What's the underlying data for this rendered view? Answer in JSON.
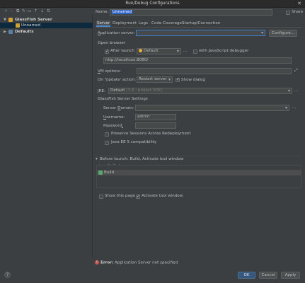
{
  "window": {
    "title": "Run/Debug Configurations",
    "close_glyph": "✕"
  },
  "left_toolbar": {
    "icons": [
      {
        "name": "add-icon",
        "glyph": "+",
        "color": "#59a869"
      },
      {
        "name": "remove-icon",
        "glyph": "−",
        "color": "#c75450"
      },
      {
        "name": "copy-icon",
        "glyph": "⧉",
        "color": "#9aa7b0"
      },
      {
        "name": "edit-icon",
        "glyph": "✎",
        "color": "#9aa7b0"
      },
      {
        "name": "folder-icon",
        "glyph": "▭",
        "color": "#9aa7b0"
      },
      {
        "name": "move-up-icon",
        "glyph": "↑",
        "color": "#9aa7b0"
      },
      {
        "name": "move-down-icon",
        "glyph": "↓",
        "color": "#9aa7b0"
      },
      {
        "name": "sort-icon",
        "glyph": "⇅",
        "color": "#9aa7b0"
      }
    ]
  },
  "tree": {
    "group": "GlassFish Server",
    "child": "Unnamed",
    "defaults": "Defaults"
  },
  "config": {
    "name_label": "Name:",
    "name_value": "Unnamed",
    "share_label": "Share",
    "tabs": [
      "Server",
      "Deployment",
      "Logs",
      "Code Coverage",
      "Startup/Connection"
    ],
    "app_server_label": "Application server:",
    "app_server_value": "",
    "configure_button": "Configure...",
    "open_browser_label": "Open browser",
    "after_launch_label": "After launch",
    "browser_value": "Default",
    "browser_more": "...",
    "with_js_debugger_label": "with JavaScript debugger",
    "url_value": "http://localhost:8080/",
    "vm_options_label": "VM options:",
    "vm_options_value": "",
    "on_update_label": "On 'Update' action:",
    "on_update_value": "Restart server",
    "show_dialog_label": "Show dialog",
    "jre_label": "JRE:",
    "jre_value": "Default",
    "jre_hint": "(1.8 - project SDK)",
    "jre_more": "...",
    "glassfish_settings_label": "GlassFish Server Settings",
    "server_domain_label": "Server Domain:",
    "server_domain_value": "",
    "username_label": "Username:",
    "username_value": "admin",
    "password_label": "Password:",
    "password_value": "",
    "preserve_sessions_label": "Preserve Sessions Across Redeployment",
    "java_ee5_label": "Java EE 5 compatibility",
    "before_launch_label": "Before launch: Build, Activate tool window",
    "before_launch_items": [
      "Build"
    ],
    "before_launch_toolbar": [
      {
        "name": "add-task-icon",
        "glyph": "+",
        "color": "#59a869"
      },
      {
        "name": "remove-task-icon",
        "glyph": "−",
        "color": "#7a7a7a"
      },
      {
        "name": "edit-task-icon",
        "glyph": "✎",
        "color": "#7a7a7a"
      },
      {
        "name": "task-up-icon",
        "glyph": "↑",
        "color": "#7a7a7a"
      },
      {
        "name": "task-down-icon",
        "glyph": "↓",
        "color": "#7a7a7a"
      }
    ],
    "show_this_page_label": "Show this page",
    "activate_tool_window_label": "Activate tool window"
  },
  "footer": {
    "error_prefix": "Error:",
    "error_text": "Application Server not specified",
    "help_glyph": "?",
    "ok": "OK",
    "cancel": "Cancel",
    "apply": "Apply"
  },
  "colors": {
    "accent": "#4a88c7",
    "selection": "#0d293e",
    "error": "#c75450",
    "panel": "#3c3f41"
  }
}
